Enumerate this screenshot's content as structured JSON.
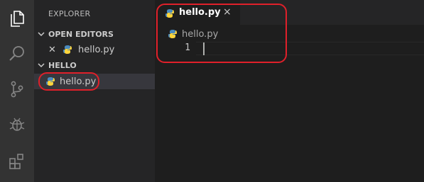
{
  "sidebar": {
    "title": "EXPLORER",
    "open_editors": {
      "header": "OPEN EDITORS",
      "items": [
        {
          "label": "hello.py"
        }
      ]
    },
    "folder": {
      "header": "HELLO",
      "items": [
        {
          "label": "hello.py"
        }
      ]
    }
  },
  "editor": {
    "tab": {
      "label": "hello.py",
      "close": "×"
    },
    "breadcrumb": "hello.py",
    "line_numbers": [
      "1"
    ]
  },
  "activity_bar": {
    "icons": [
      "files-icon",
      "search-icon",
      "source-control-icon",
      "debug-icon",
      "extensions-icon"
    ]
  },
  "colors": {
    "activity_bar": "#333333",
    "sidebar": "#252526",
    "editor": "#1e1e1e",
    "annotation": "#e0202a",
    "python_blue": "#4b8bbe",
    "python_yellow": "#ffd43b"
  }
}
